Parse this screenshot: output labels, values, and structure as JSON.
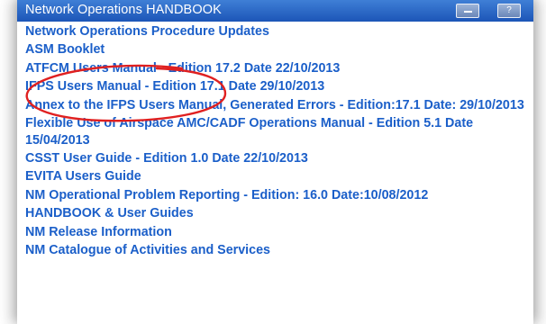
{
  "window": {
    "title": "Network Operations HANDBOOK",
    "minimize_icon": "minimize-icon",
    "help_label": "?"
  },
  "links": [
    "Network Operations Procedure Updates",
    "ASM Booklet",
    "ATFCM Users Manual - Edition 17.2 Date 22/10/2013",
    "IFPS Users Manual - Edition 17.1 Date 29/10/2013",
    "Annex to the IFPS Users Manual, Generated Errors - Edition:17.1 Date: 29/10/2013",
    "Flexible Use of Airspace AMC/CADF Operations Manual - Edition 5.1 Date 15/04/2013",
    "CSST User Guide - Edition 1.0 Date 22/10/2013",
    "EVITA Users Guide",
    "NM Operational Problem Reporting - Edition: 16.0 Date:10/08/2012",
    "HANDBOOK & User Guides",
    "NM Release Information",
    "NM Catalogue of Activities and Services"
  ],
  "colors": {
    "link": "#1b5fc9",
    "titlebar": "#2a66c6",
    "annotation": "#e02020"
  }
}
